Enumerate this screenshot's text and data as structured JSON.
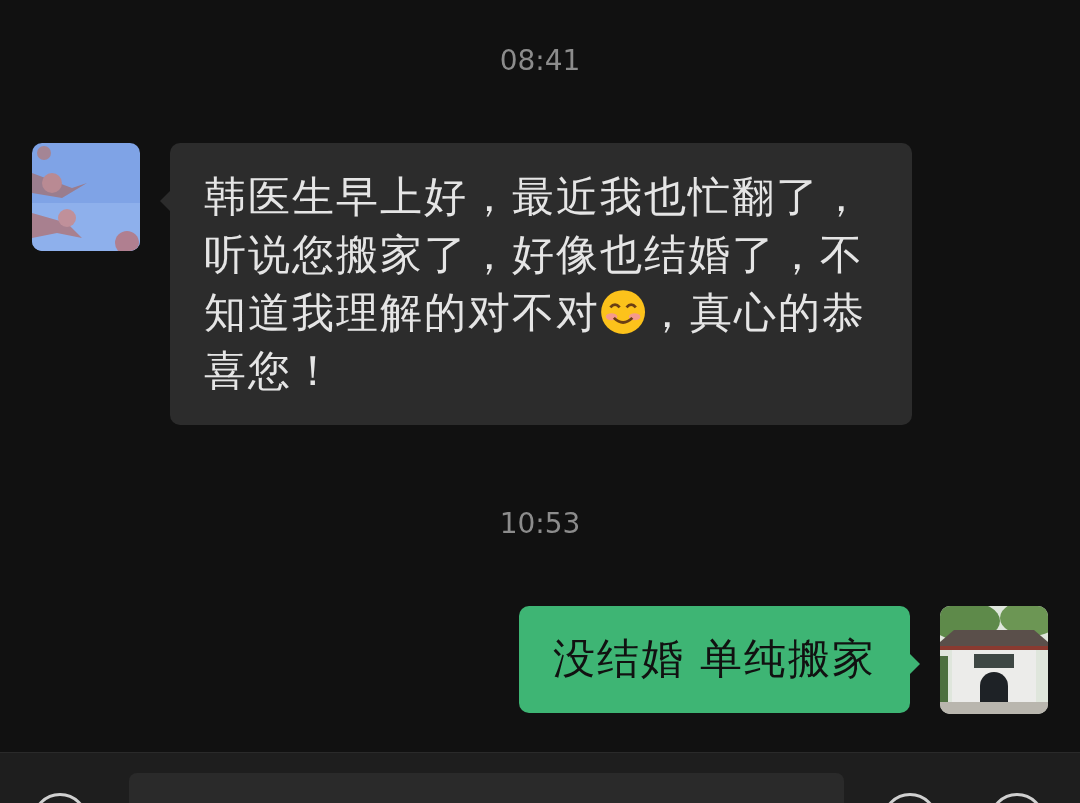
{
  "messages": [
    {
      "kind": "time",
      "text": "08:41"
    },
    {
      "kind": "received",
      "parts": [
        {
          "kind": "text",
          "text": "韩医生早上好，最近我也忙翻了，听说您搬家了，好像也结婚了，不知道我理解的对不对"
        },
        {
          "kind": "emoji"
        },
        {
          "kind": "text",
          "text": "，真心的恭喜您！"
        }
      ]
    },
    {
      "kind": "time",
      "text": "10:53"
    },
    {
      "kind": "sent",
      "parts": [
        {
          "kind": "text",
          "text": "没结婚 单纯搬家"
        }
      ]
    }
  ]
}
